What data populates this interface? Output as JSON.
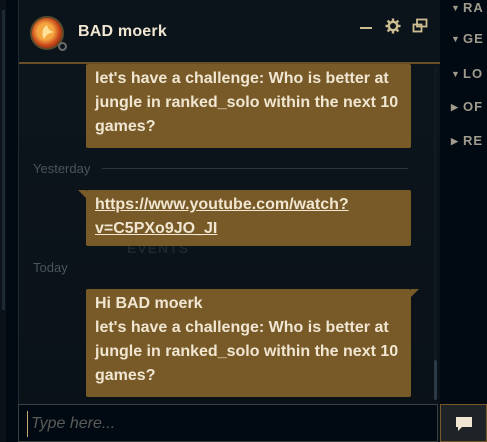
{
  "chat": {
    "friend_name": "BAD moerk",
    "messages": [
      {
        "lines": [
          "let's have a challenge: Who is better at",
          "jungle in ranked_solo within the next 10",
          "games?"
        ]
      },
      {
        "link_line1": "https://www.youtube.com/watch?",
        "link_line2": "v=C5PXo9JO_JI"
      },
      {
        "lines": [
          "Hi BAD moerk",
          "let's have a challenge: Who is better at",
          "jungle in ranked_solo within the next 10",
          "games?"
        ]
      }
    ],
    "dividers": {
      "yesterday": "Yesterday",
      "today": "Today"
    },
    "background_text": "EVENTS",
    "input_placeholder": "Type here..."
  },
  "right_menu": [
    {
      "arrow": "▼",
      "label": "RA"
    },
    {
      "arrow": "▼",
      "label": "GE"
    },
    {
      "arrow": "▼",
      "label": "LO"
    },
    {
      "arrow": "▶",
      "label": "OF"
    },
    {
      "arrow": "▶",
      "label": "RE"
    }
  ],
  "colors": {
    "bubble": "#785a28",
    "text": "#f0e6d2",
    "background": "#010a13"
  }
}
